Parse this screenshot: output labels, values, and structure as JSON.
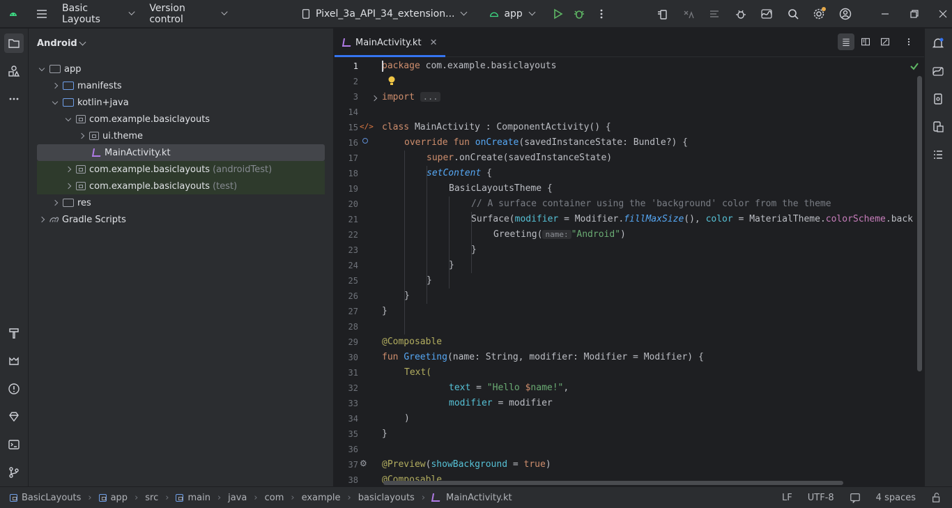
{
  "titlebar": {
    "project": "Basic Layouts",
    "vcs": "Version control",
    "device": "Pixel_3a_API_34_extension...",
    "run_config": "app"
  },
  "project_panel": {
    "view_mode": "Android",
    "tree": [
      {
        "label": "app",
        "suffix": ""
      },
      {
        "label": "manifests",
        "suffix": ""
      },
      {
        "label": "kotlin+java",
        "suffix": ""
      },
      {
        "label": "com.example.basiclayouts",
        "suffix": ""
      },
      {
        "label": "ui.theme",
        "suffix": ""
      },
      {
        "label": "MainActivity.kt",
        "suffix": ""
      },
      {
        "label": "com.example.basiclayouts",
        "suffix": "(androidTest)"
      },
      {
        "label": "com.example.basiclayouts",
        "suffix": "(test)"
      },
      {
        "label": "res",
        "suffix": ""
      },
      {
        "label": "Gradle Scripts",
        "suffix": ""
      }
    ]
  },
  "editor": {
    "tab_label": "MainActivity.kt",
    "line_numbers": [
      "1",
      "2",
      "3",
      "14",
      "15",
      "16",
      "17",
      "18",
      "19",
      "20",
      "21",
      "22",
      "23",
      "24",
      "25",
      "26",
      "27",
      "28",
      "29",
      "30",
      "31",
      "32",
      "33",
      "34",
      "35",
      "36",
      "37",
      "38"
    ]
  },
  "code": {
    "l1_kw": "package",
    "l1_rest": " com.example.basiclayouts",
    "l3_kw": "import",
    "l3_fold": "...",
    "l15_kw": "class",
    "l15_rest": " MainActivity : ComponentActivity() {",
    "l16_kw": "override fun",
    "l16_fn": "onCreate",
    "l16_rest": "(savedInstanceState: Bundle?) {",
    "l17_kw": "super",
    "l17_rest": ".onCreate(savedInstanceState)",
    "l18_fn": "setContent",
    "l18_rest": " {",
    "l19": "BasicLayoutsTheme {",
    "l20": "// A surface container using the 'background' color from the theme",
    "l21_a": "Surface(",
    "l21_param": "modifier",
    "l21_b": " = Modifier.",
    "l21_fn": "fillMaxSize",
    "l21_c": "(), ",
    "l21_param2": "color",
    "l21_d": " = MaterialTheme.",
    "l21_pr": "colorScheme",
    "l21_e": ".back",
    "l22_a": "Greeting(",
    "l22_hint": "name:",
    "l22_str": "\"Android\"",
    "l22_b": ")",
    "l23": "}",
    "l24": "}",
    "l25": "}",
    "l26": "}",
    "l27": "}",
    "l29": "@Composable",
    "l30_kw": "fun",
    "l30_fn": "Greeting",
    "l30_rest": "(name: String, modifier: Modifier = Modifier) {",
    "l31": "Text(",
    "l32_param": "text",
    "l32_a": " = ",
    "l32_str": "\"Hello ",
    "l32_var": "$",
    "l32_str2": "name!\"",
    "l32_b": ",",
    "l33_param": "modifier",
    "l33_rest": " = modifier",
    "l34": ")",
    "l35": "}",
    "l37_an": "@Preview",
    "l37_a": "(",
    "l37_param": "showBackground",
    "l37_b": " = ",
    "l37_kw": "true",
    "l37_c": ")",
    "l38": "@Composable"
  },
  "statusbar": {
    "breadcrumb": [
      "BasicLayouts",
      "app",
      "src",
      "main",
      "java",
      "com",
      "example",
      "basiclayouts",
      "MainActivity.kt"
    ],
    "line_sep": "LF",
    "encoding": "UTF-8",
    "indent": "4 spaces"
  },
  "colors": {
    "accent": "#3574f0",
    "keyword": "#cf8e6d",
    "function": "#56a8f5",
    "string": "#6aab73",
    "annotation": "#b3ae60"
  }
}
